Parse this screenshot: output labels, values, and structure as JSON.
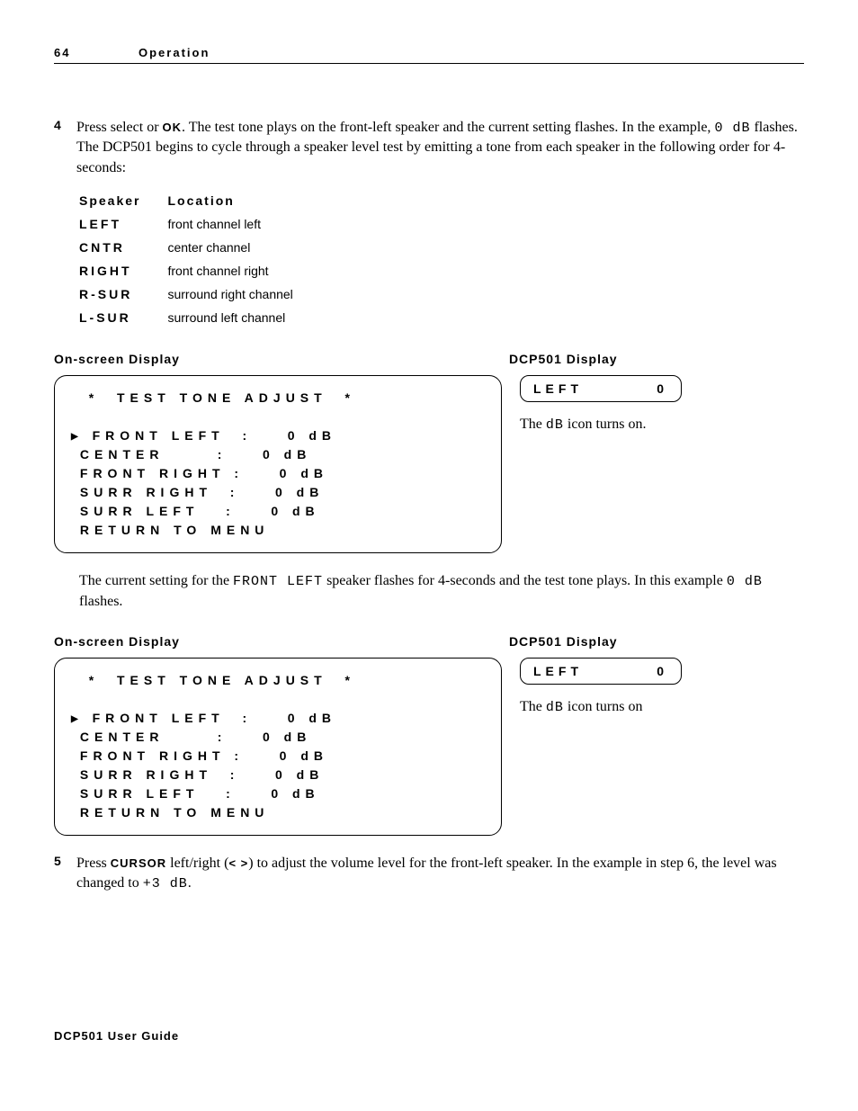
{
  "header": {
    "page": "64",
    "section": "Operation"
  },
  "step4": {
    "num": "4",
    "text_a": "Press select or ",
    "ok": "OK",
    "text_b": ". The test tone plays on the front-left speaker and the current setting flashes. In the example, ",
    "val": "0 dB",
    "text_c": " flashes. The DCP501 begins to cycle through a speaker level test by emitting a tone from each speaker in the following order for 4-seconds:"
  },
  "speaker_table": {
    "h1": "Speaker",
    "h2": "Location",
    "rows": [
      {
        "code": "LEFT",
        "loc": "front channel left"
      },
      {
        "code": "CNTR",
        "loc": "center channel"
      },
      {
        "code": "RIGHT",
        "loc": "front channel right"
      },
      {
        "code": "R-SUR",
        "loc": "surround right channel"
      },
      {
        "code": "L-SUR",
        "loc": "surround left channel"
      }
    ]
  },
  "labels": {
    "osd": "On-screen Display",
    "dcp": "DCP501 Display"
  },
  "osd1": {
    "title": "  *  TEST TONE ADJUST  *",
    "l1": " FRONT LEFT  :    0 dB",
    "l2": " CENTER      :    0 dB",
    "l3": " FRONT RIGHT :    0 dB",
    "l4": " SURR RIGHT  :    0 dB",
    "l5": " SURR LEFT   :    0 dB",
    "l6": " RETURN TO MENU"
  },
  "dcp1": {
    "label": "LEFT",
    "val": "0",
    "caption_a": "The ",
    "caption_code": "dB",
    "caption_b": " icon turns on."
  },
  "mid_para": {
    "a": "The current setting for the ",
    "code": "FRONT LEFT",
    "b": " speaker flashes for 4-seconds and the test tone plays. In this example ",
    "val": "0 dB",
    "c": " flashes."
  },
  "dcp2": {
    "label": "LEFT",
    "val": "0",
    "caption_a": "The ",
    "caption_code": "dB",
    "caption_b": " icon turns on"
  },
  "step5": {
    "num": "5",
    "a": "Press ",
    "cursor": "CURSOR",
    "b": " left/right (",
    "arrows": "< >",
    "c": ") to adjust the volume level for the front-left speaker. In the example in step 6, the level was changed to ",
    "val": "+3 dB",
    "d": "."
  },
  "footer": "DCP501 User Guide"
}
